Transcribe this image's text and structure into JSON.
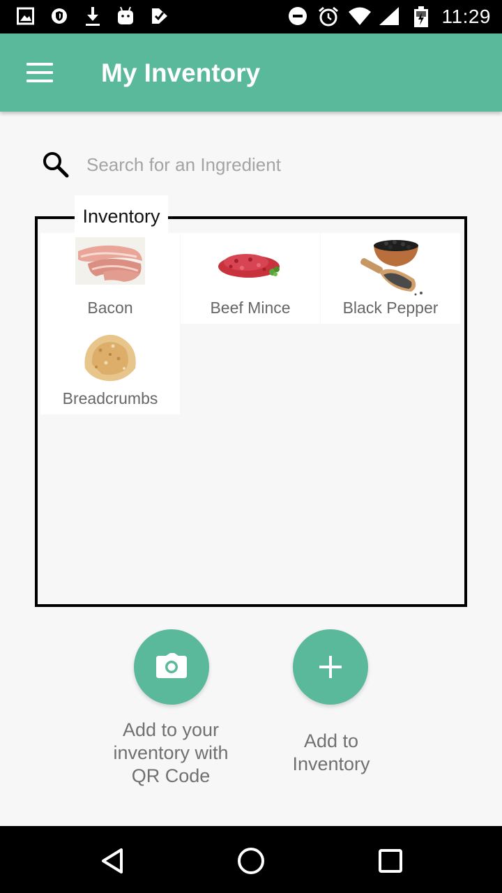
{
  "status_bar": {
    "time": "11:29",
    "icons": [
      "image-icon",
      "shield-icon",
      "download-icon",
      "android-icon",
      "app-icon",
      "do-not-disturb-icon",
      "alarm-icon",
      "wifi-icon",
      "signal-icon",
      "battery-icon"
    ]
  },
  "app_bar": {
    "title": "My Inventory",
    "color": "#59b99a"
  },
  "search": {
    "placeholder": "Search for an Ingredient",
    "value": ""
  },
  "inventory": {
    "legend": "Inventory",
    "items": [
      {
        "label": "Bacon",
        "image": "bacon"
      },
      {
        "label": "Beef Mince",
        "image": "beef-mince"
      },
      {
        "label": "Black Pepper",
        "image": "black-pepper"
      },
      {
        "label": "Breadcrumbs",
        "image": "breadcrumbs"
      }
    ]
  },
  "actions": {
    "qr_label": "Add to your inventory with QR Code",
    "add_label": "Add to Inventory"
  },
  "nav_bar": {
    "buttons": [
      "back-icon",
      "home-icon",
      "recents-icon"
    ]
  }
}
